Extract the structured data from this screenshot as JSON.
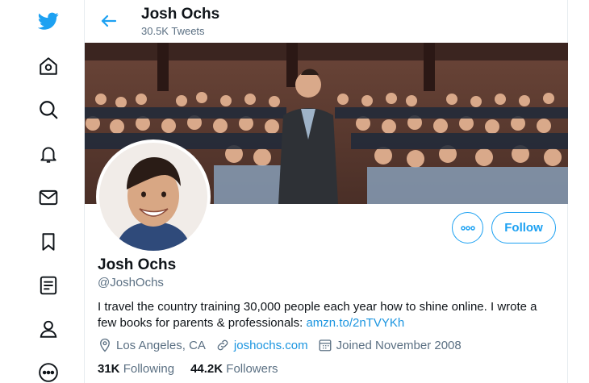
{
  "header": {
    "name": "Josh Ochs",
    "tweet_count": "30.5K Tweets"
  },
  "nav": {
    "items": [
      "twitter-logo",
      "home",
      "explore",
      "notifications",
      "messages",
      "bookmarks",
      "lists",
      "profile",
      "more"
    ]
  },
  "actions": {
    "follow_label": "Follow"
  },
  "profile": {
    "name": "Josh Ochs",
    "handle": "@JoshOchs",
    "bio_text": "I travel the country training 30,000 people each year how to shine online. I wrote a few books for parents & professionals: ",
    "bio_link": "amzn.to/2nTVYKh",
    "location": "Los Angeles, CA",
    "website": "joshochs.com",
    "joined": "Joined November 2008",
    "following_count": "31K",
    "following_label": "Following",
    "followers_count": "44.2K",
    "followers_label": "Followers"
  },
  "colors": {
    "accent": "#1da1f2",
    "secondary_text": "#5b7083"
  }
}
